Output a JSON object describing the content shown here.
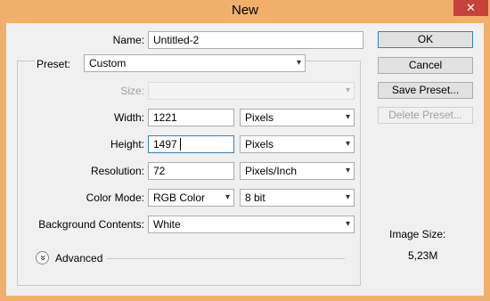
{
  "window": {
    "title": "New",
    "close_label": "✕"
  },
  "form": {
    "name_label": "Name:",
    "name_value": "Untitled-2",
    "preset_label": "Preset:",
    "preset_value": "Custom",
    "size_label": "Size:",
    "size_value": "",
    "width_label": "Width:",
    "width_value": "1221",
    "width_unit": "Pixels",
    "height_label": "Height:",
    "height_value": "1497",
    "height_unit": "Pixels",
    "resolution_label": "Resolution:",
    "resolution_value": "72",
    "resolution_unit": "Pixels/Inch",
    "color_mode_label": "Color Mode:",
    "color_mode_value": "RGB Color",
    "bit_depth_value": "8 bit",
    "background_label": "Background Contents:",
    "background_value": "White",
    "advanced_label": "Advanced"
  },
  "buttons": {
    "ok": "OK",
    "cancel": "Cancel",
    "save_preset": "Save Preset...",
    "delete_preset": "Delete Preset..."
  },
  "image_size": {
    "label": "Image Size:",
    "value": "5,23M"
  },
  "icons": {
    "dropdown": "▾",
    "expand": "»"
  }
}
